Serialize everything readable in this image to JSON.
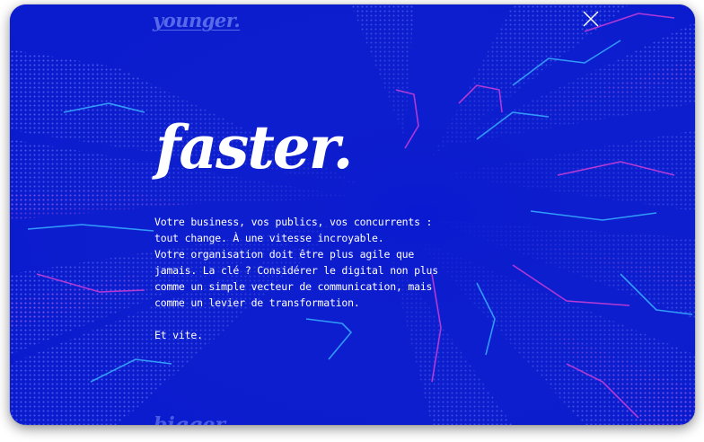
{
  "brand": {
    "top_word": "younger.",
    "bottom_word": "bigger."
  },
  "hero": {
    "title": "faster.",
    "lines": [
      "Votre business, vos publics, vos concurrents :",
      "tout change. À une vitesse incroyable.",
      "Votre organisation doit être plus agile que",
      "jamais. La clé ? Considérer le digital non plus",
      "comme un simple vecteur de communication, mais",
      "comme un levier de transformation."
    ],
    "signoff": "Et vite."
  },
  "controls": {
    "close_icon": "close-icon"
  },
  "colors": {
    "background": "#0b1ccf",
    "accent_pink": "#c33cd6",
    "accent_cyan": "#36a8ff",
    "text": "#ffffff"
  }
}
